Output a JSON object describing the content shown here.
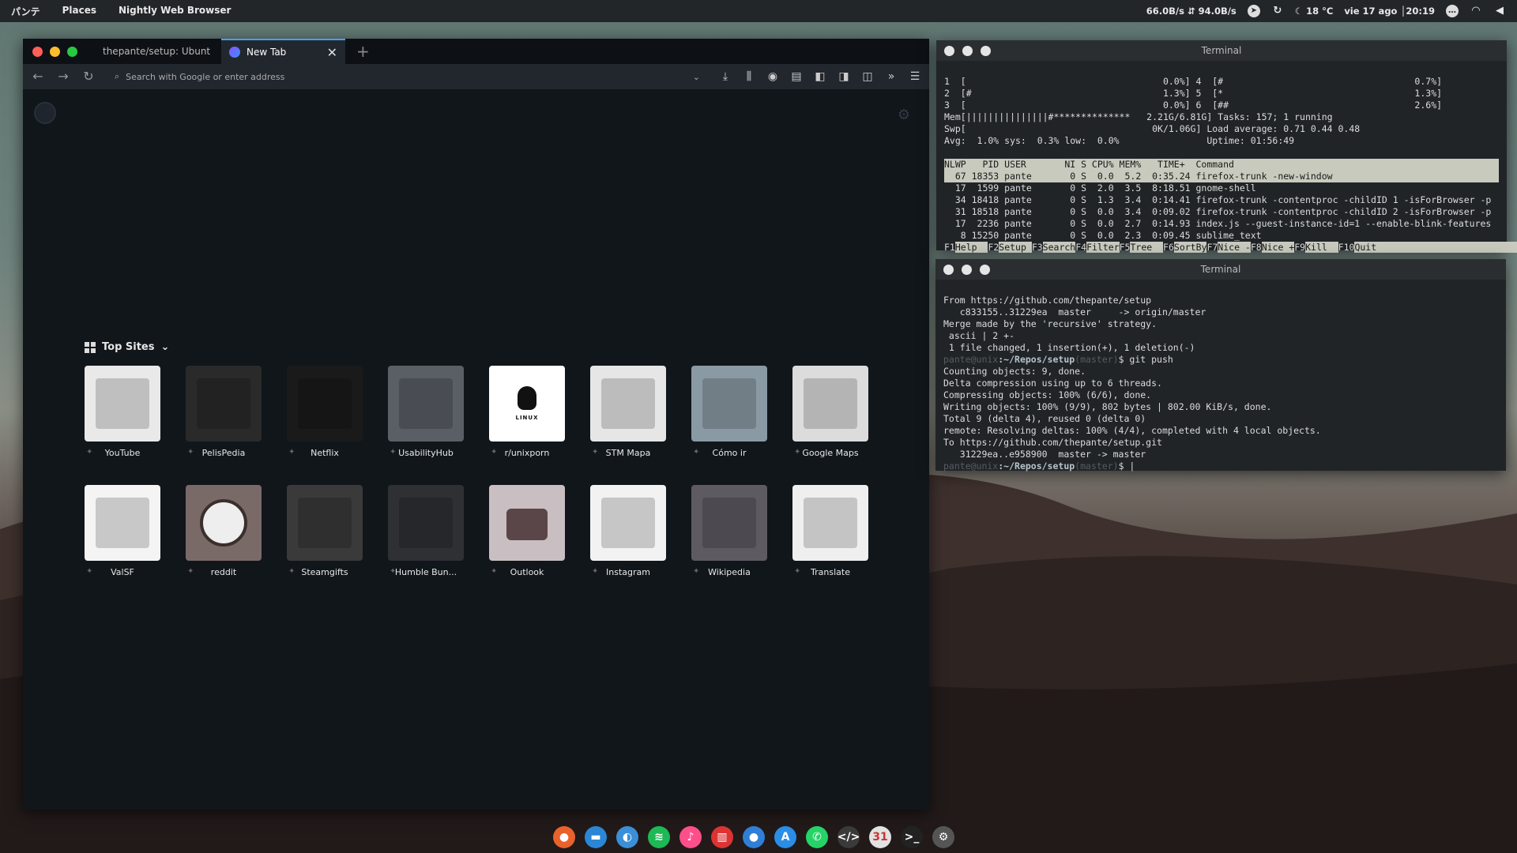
{
  "topbar": {
    "activities": "パンテ",
    "places": "Places",
    "app_name": "Nightly Web Browser",
    "net_speed": "66.0B/s ⇵ 94.0B/s",
    "temperature": "18 °C",
    "datetime": "vie 17 ago │20:19"
  },
  "browser": {
    "tabs": [
      {
        "label": "thepante/setup: Ubunt",
        "active": false
      },
      {
        "label": "New Tab",
        "active": true
      }
    ],
    "url_placeholder": "Search with Google or enter address",
    "top_sites_label": "Top Sites",
    "sites": [
      {
        "label": "YouTube",
        "bg": "#e9e9e9"
      },
      {
        "label": "PelisPedia",
        "bg": "#2a2a2a"
      },
      {
        "label": "Netflix",
        "bg": "#1a1a1a"
      },
      {
        "label": "UsabilityHub",
        "bg": "#5a5f66"
      },
      {
        "label": "r/unixporn",
        "bg": "#ffffff"
      },
      {
        "label": "STM Mapa",
        "bg": "#e6e6e6"
      },
      {
        "label": "Cómo ir",
        "bg": "#8a9aa4"
      },
      {
        "label": "Google Maps",
        "bg": "#dcdcdc"
      },
      {
        "label": "ValSF",
        "bg": "#f4f4f4"
      },
      {
        "label": "reddit",
        "bg": "#7a6a67"
      },
      {
        "label": "Steamgifts",
        "bg": "#3a3a3a"
      },
      {
        "label": "Humble Bun...",
        "bg": "#2f3034"
      },
      {
        "label": "Outlook",
        "bg": "#c9bfc2"
      },
      {
        "label": "Instagram",
        "bg": "#f2f2f2"
      },
      {
        "label": "Wikipedia",
        "bg": "#5d5a62"
      },
      {
        "label": "Translate",
        "bg": "#efefef"
      }
    ],
    "linux_text": "LINUX"
  },
  "term1": {
    "title": "Terminal",
    "cpu_lines": [
      "1  [                                    0.0%] 4  [#                                   0.7%]",
      "2  [#                                   1.3%] 5  [*                                   1.3%]",
      "3  [                                    0.0%] 6  [##                                  2.6%]"
    ],
    "mem_line": "Mem[|||||||||||||||#**************   2.21G/6.81G] Tasks: 157; 1 running",
    "swp_line": "Swp[                                  0K/1.06G] Load average: 0.71 0.44 0.48",
    "avg_line": "Avg:  1.0% sys:  0.3% low:  0.0%                Uptime: 01:56:49",
    "header": "NLWP   PID USER       NI S CPU% MEM%   TIME+  Command                         ",
    "rows": [
      "  67 18353 pante       0 S  0.0  5.2  0:35.24 firefox-trunk -new-window      ",
      "  17  1599 pante       0 S  2.0  3.5  8:18.51 gnome-shell",
      "  34 18418 pante       0 S  1.3  3.4  0:14.41 firefox-trunk -contentproc -childID 1 -isForBrowser -p",
      "  31 18518 pante       0 S  0.0  3.4  0:09.02 firefox-trunk -contentproc -childID 2 -isForBrowser -p",
      "  17  2236 pante       0 S  0.0  2.7  0:14.93 index.js --guest-instance-id=1 --enable-blink-features",
      "   8 15250 pante       0 S  0.0  2.3  0:09.45 sublime_text"
    ],
    "fkeys": [
      {
        "k": "F1",
        "v": "Help  "
      },
      {
        "k": "F2",
        "v": "Setup "
      },
      {
        "k": "F3",
        "v": "Search"
      },
      {
        "k": "F4",
        "v": "Filter"
      },
      {
        "k": "F5",
        "v": "Tree  "
      },
      {
        "k": "F6",
        "v": "SortBy"
      },
      {
        "k": "F7",
        "v": "Nice -"
      },
      {
        "k": "F8",
        "v": "Nice +"
      },
      {
        "k": "F9",
        "v": "Kill  "
      },
      {
        "k": "F10",
        "v": "Quit                                      "
      }
    ]
  },
  "term2": {
    "title": "Terminal",
    "lines": [
      "From https://github.com/thepante/setup",
      "   c833155..31229ea  master     -> origin/master",
      "Merge made by the 'recursive' strategy.",
      " ascii | 2 +-",
      " 1 file changed, 1 insertion(+), 1 deletion(-)"
    ],
    "prompt_user": "pante@unix",
    "prompt_path": ":~/Repos/setup",
    "prompt_branch": "(master)",
    "cmd1": "$ git push",
    "lines2": [
      "Counting objects: 9, done.",
      "Delta compression using up to 6 threads.",
      "Compressing objects: 100% (6/6), done.",
      "Writing objects: 100% (9/9), 802 bytes | 802.00 KiB/s, done.",
      "Total 9 (delta 4), reused 0 (delta 0)",
      "remote: Resolving deltas: 100% (4/4), completed with 4 local objects.",
      "To https://github.com/thepante/setup.git",
      "   31229ea..e958900  master -> master"
    ],
    "cmd2": "$ |"
  },
  "dock": [
    {
      "name": "firefox",
      "color": "#e8622a",
      "glyph": "●"
    },
    {
      "name": "files",
      "color": "#2b86d6",
      "glyph": "▬"
    },
    {
      "name": "browser",
      "color": "#3a8fd8",
      "glyph": "◐"
    },
    {
      "name": "spotify",
      "color": "#1db954",
      "glyph": "≋"
    },
    {
      "name": "music",
      "color": "#ff4f8a",
      "glyph": "♪"
    },
    {
      "name": "popcorn",
      "color": "#d33",
      "glyph": "▥"
    },
    {
      "name": "firefox-nightly",
      "color": "#2f7fd6",
      "glyph": "●"
    },
    {
      "name": "app-a",
      "color": "#2a8de6",
      "glyph": "A"
    },
    {
      "name": "whatsapp",
      "color": "#25d366",
      "glyph": "✆"
    },
    {
      "name": "code-editor",
      "color": "#3a3a3a",
      "glyph": "</>"
    },
    {
      "name": "calendar",
      "color": "#e2e2e2",
      "glyph": "31"
    },
    {
      "name": "terminal",
      "color": "#222",
      "glyph": ">_"
    },
    {
      "name": "settings",
      "color": "#555",
      "glyph": "⚙"
    }
  ]
}
